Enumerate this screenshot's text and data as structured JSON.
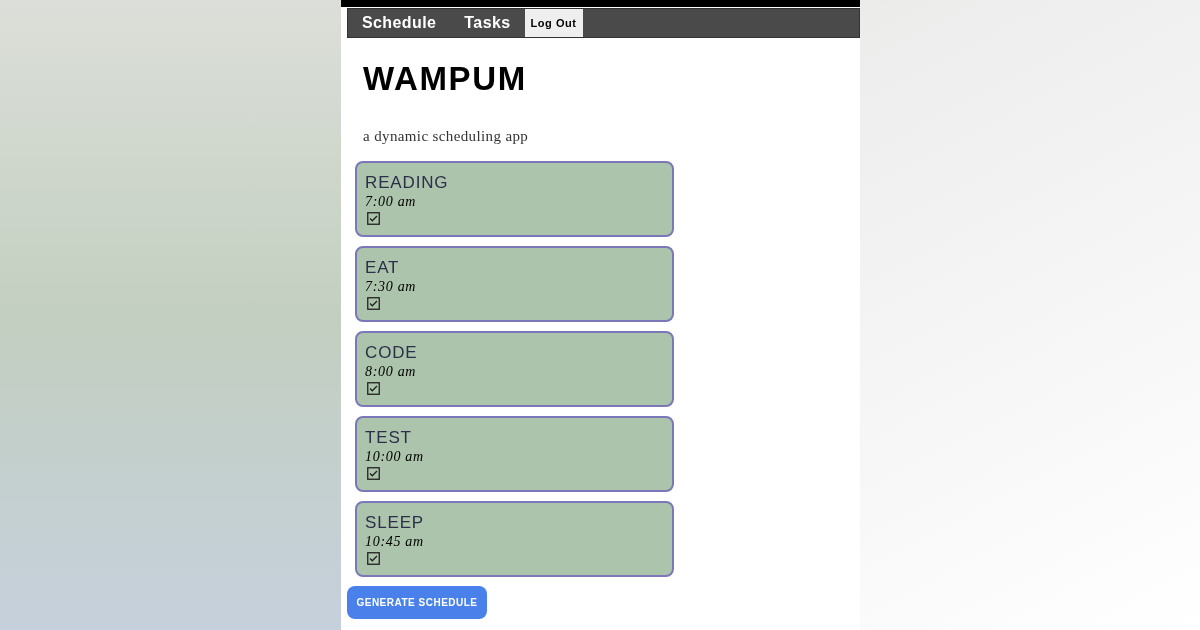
{
  "nav": {
    "links": [
      {
        "label": "Schedule"
      },
      {
        "label": "Tasks"
      }
    ],
    "logout": "Log Out"
  },
  "title": "WAMPUM",
  "subtitle": "a dynamic scheduling app",
  "tasks": [
    {
      "name": "READING",
      "time": "7:00 am",
      "checked": true
    },
    {
      "name": "EAT",
      "time": "7:30 am",
      "checked": true
    },
    {
      "name": "CODE",
      "time": "8:00 am",
      "checked": true
    },
    {
      "name": "TEST",
      "time": "10:00 am",
      "checked": true
    },
    {
      "name": "SLEEP",
      "time": "10:45 am",
      "checked": true
    }
  ],
  "button": "GENERATE SCHEDULE"
}
